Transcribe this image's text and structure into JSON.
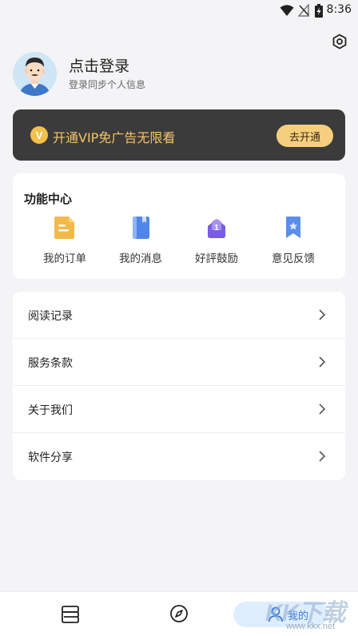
{
  "status_bar": {
    "time": "8:36"
  },
  "profile": {
    "title": "点击登录",
    "subtitle": "登录同步个人信息"
  },
  "vip": {
    "badge": "V",
    "text": "开通VIP免广告无限看",
    "button": "去开通"
  },
  "functions": {
    "title": "功能中心",
    "items": [
      {
        "label": "我的订单",
        "icon": "order-icon",
        "color": "#f3b94a"
      },
      {
        "label": "我的消息",
        "icon": "message-book-icon",
        "color": "#4f86e8"
      },
      {
        "label": "好評鼓励",
        "icon": "rating-badge-icon",
        "color": "#7a5ce0"
      },
      {
        "label": "意见反馈",
        "icon": "feedback-bookmark-icon",
        "color": "#5b8ee6"
      }
    ]
  },
  "menu": [
    {
      "label": "阅读记录"
    },
    {
      "label": "服务条款"
    },
    {
      "label": "关于我们"
    },
    {
      "label": "软件分享"
    }
  ],
  "bottom_nav": {
    "mine_label": "我的"
  },
  "watermark": {
    "big": "KK下载",
    "small": "www.kkx.net"
  },
  "colors": {
    "vip_bg": "#3b3b3b",
    "vip_text": "#f4c46a",
    "vip_button": "#f6cf7e",
    "active_tab": "#3a7be0"
  }
}
